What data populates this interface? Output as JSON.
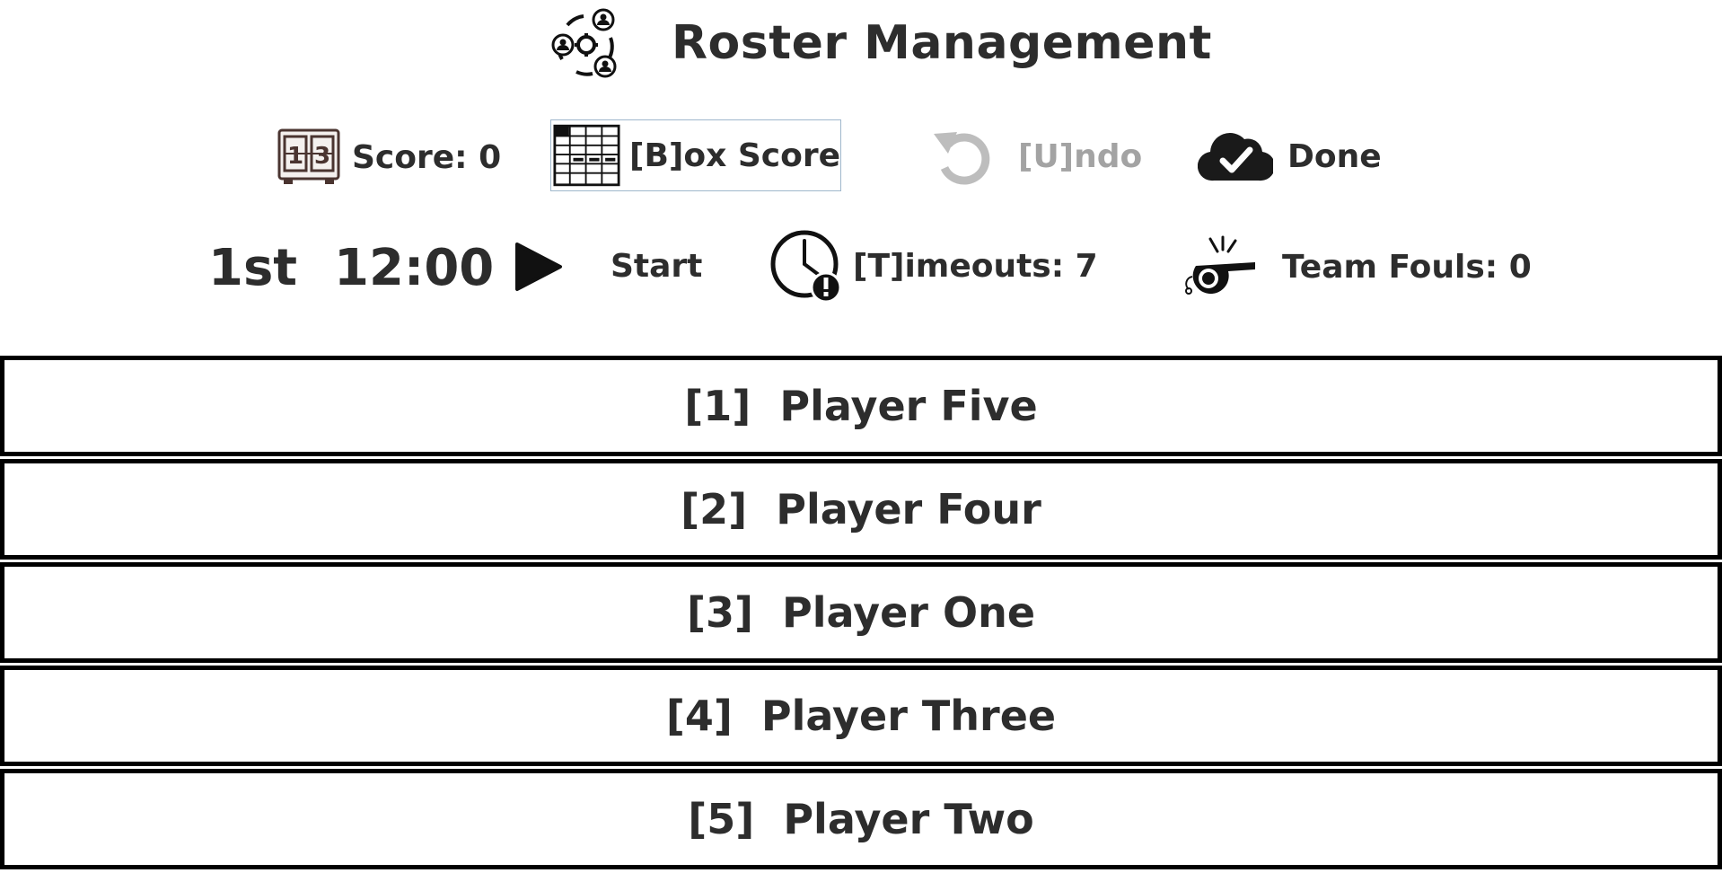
{
  "header": {
    "title": "Roster Management",
    "logo_icon": "roster-team-icon"
  },
  "toolbar": {
    "score_label": "Score: 0",
    "score_icon": "scoreboard-icon",
    "box_score_label": "[B]ox Score",
    "box_score_icon": "box-score-grid-icon",
    "undo_label": "[U]ndo",
    "undo_icon": "undo-arrow-icon",
    "done_label": "Done",
    "done_icon": "cloud-check-icon"
  },
  "game": {
    "period": "1st",
    "clock": "12:00",
    "start_label": "Start",
    "timeouts_label": "[T]imeouts: 7",
    "timeouts_icon": "clock-alert-icon",
    "fouls_label": "Team Fouls: 0",
    "fouls_icon": "whistle-icon"
  },
  "roster": [
    {
      "label": "[1]  Player Five"
    },
    {
      "label": "[2]  Player Four"
    },
    {
      "label": "[3]  Player One"
    },
    {
      "label": "[4]  Player Three"
    },
    {
      "label": "[5]  Player Two"
    }
  ],
  "colors": {
    "text": "#2d2d2d",
    "disabled_text": "#a3a3a3",
    "row_border": "#000000",
    "box_score_border": "#9fb7cc"
  }
}
